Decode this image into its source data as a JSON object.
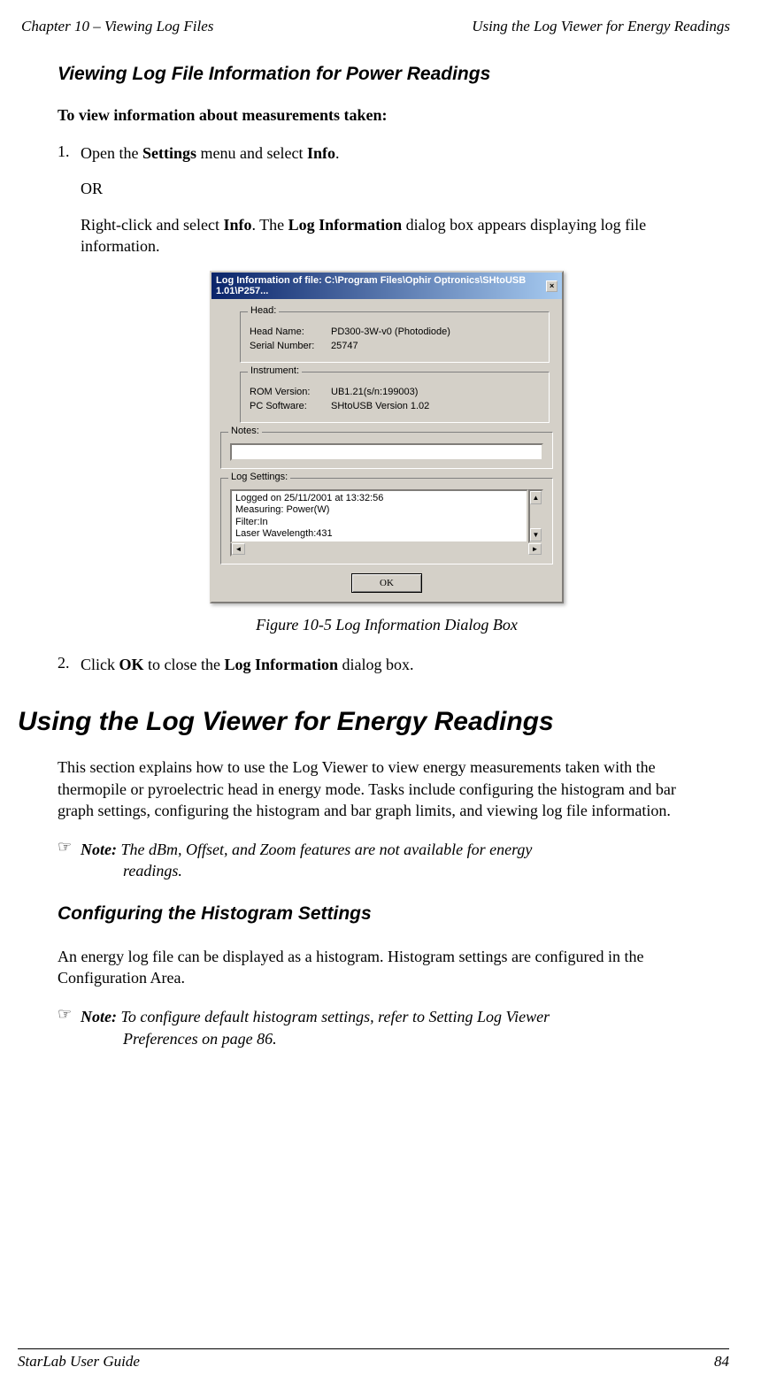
{
  "header": {
    "left": "Chapter 10 – Viewing Log Files",
    "right": "Using the Log Viewer for Energy Readings"
  },
  "sect1": {
    "title": "Viewing Log File Information for Power Readings",
    "lead": "To view information about measurements taken:",
    "step1_num": "1.",
    "step1_a": "Open the ",
    "step1_b": "Settings",
    "step1_c": " menu and select ",
    "step1_d": "Info",
    "step1_e": ".",
    "step1_or": "OR",
    "step1_f": "Right-click and select ",
    "step1_g": "Info",
    "step1_h": ". The ",
    "step1_i": "Log Information",
    "step1_j": " dialog box appears displaying log file information.",
    "caption": "Figure 10-5 Log Information Dialog Box",
    "step2_num": "2.",
    "step2_a": "Click ",
    "step2_b": "OK",
    "step2_c": " to close the ",
    "step2_d": "Log Information",
    "step2_e": " dialog box."
  },
  "dialog": {
    "title": "Log Information of file: C:\\Program Files\\Ophir Optronics\\SHtoUSB 1.01\\P257...",
    "close": "×",
    "head_label": "Head:",
    "head_name_lbl": "Head Name:",
    "head_name_val": "PD300-3W-v0 (Photodiode)",
    "serial_lbl": "Serial Number:",
    "serial_val": "25747",
    "instr_label": "Instrument:",
    "rom_lbl": "ROM Version:",
    "rom_val": "UB1.21(s/n:199003)",
    "pcsw_lbl": "PC Software:",
    "pcsw_val": "SHtoUSB Version 1.02",
    "notes_label": "Notes:",
    "logset_label": "Log Settings:",
    "log_text": "Logged on 25/11/2001 at 13:32:56\nMeasuring: Power(W)\nFilter:In\nLaser Wavelength:431",
    "up": "▲",
    "down": "▼",
    "left": "◄",
    "right": "►",
    "ok": "OK"
  },
  "sect2": {
    "title": "Using the Log Viewer for Energy Readings",
    "para": "This section explains how to use the Log Viewer to view energy measurements taken with the thermopile or pyroelectric head in energy mode. Tasks include configuring the histogram and bar graph settings, configuring the histogram and bar graph limits, and viewing log file information.",
    "note_icon": "☞",
    "note_lbl": "Note:",
    "note_txt1": " The dBm, Offset, and Zoom features are not available for energy ",
    "note_txt2": "readings.",
    "h3": "Configuring the Histogram Settings",
    "para2": "An energy log file can be displayed as a histogram. Histogram settings are configured in the Configuration Area.",
    "note2_txt1": " To configure default histogram settings, refer to Setting Log Viewer ",
    "note2_txt2": "Preferences on page 86."
  },
  "footer": {
    "left": "StarLab User Guide",
    "right": "84"
  }
}
